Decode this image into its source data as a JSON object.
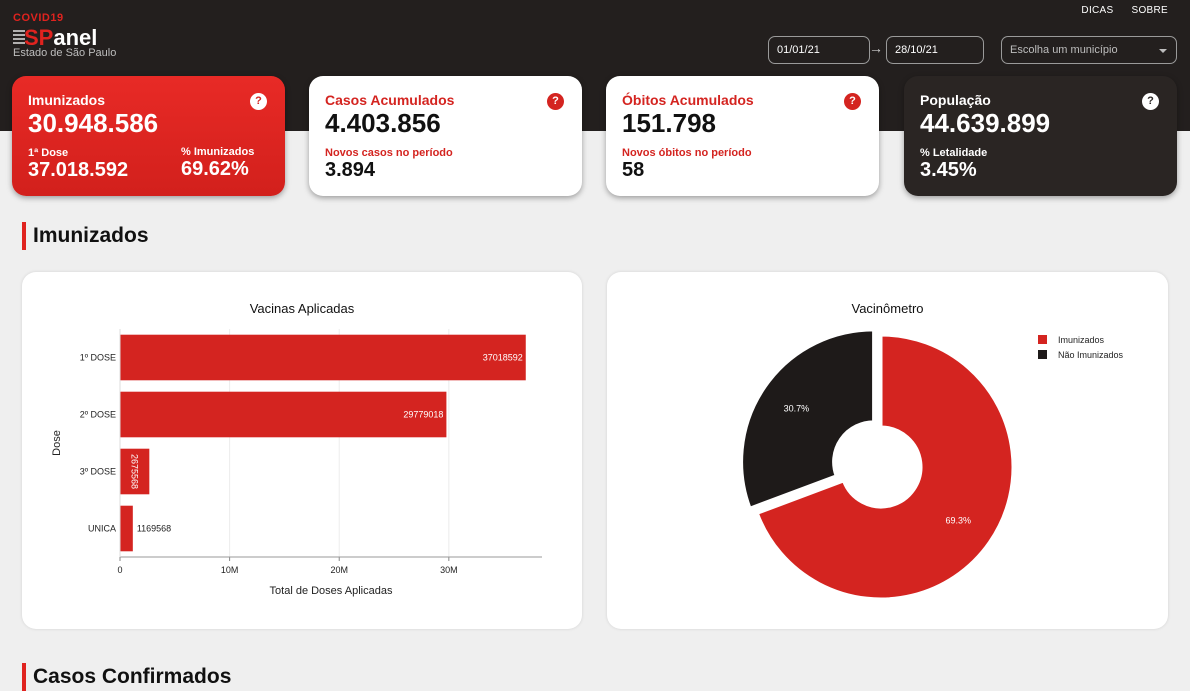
{
  "brand": {
    "tag": "COVID19",
    "logo_sp": "SP",
    "logo_rest": "anel",
    "subtitle": "Estado de São Paulo"
  },
  "nav": {
    "tips": "DICAS",
    "about": "SOBRE"
  },
  "filters": {
    "date_start": "01/01/21",
    "date_end": "28/10/21",
    "municipality_placeholder": "Escolha um município"
  },
  "cards": {
    "immunized": {
      "title": "Imunizados",
      "value": "30.948.586",
      "dose1_label": "1ª Dose",
      "dose1_value": "37.018.592",
      "pct_label": "% Imunizados",
      "pct_value": "69.62%"
    },
    "cases": {
      "title": "Casos Acumulados",
      "value": "4.403.856",
      "period_label": "Novos casos no período",
      "period_value": "3.894"
    },
    "deaths": {
      "title": "Óbitos Acumulados",
      "value": "151.798",
      "period_label": "Novos óbitos no período",
      "period_value": "58"
    },
    "population": {
      "title": "População",
      "value": "44.639.899",
      "lethality_label": "% Letalidade",
      "lethality_value": "3.45%"
    },
    "help": "?"
  },
  "sections": {
    "immunized": "Imunizados",
    "confirmed": "Casos Confirmados"
  },
  "colors": {
    "accent": "#d42420",
    "dark": "#1e1a19"
  },
  "chart_data": [
    {
      "type": "bar",
      "orientation": "horizontal",
      "title": "Vacinas Aplicadas",
      "xlabel": "Total de Doses Aplicadas",
      "ylabel": "Dose",
      "categories": [
        "1º DOSE",
        "2º DOSE",
        "3º DOSE",
        "UNICA"
      ],
      "values": [
        37018592,
        29779018,
        2675568,
        1169568
      ],
      "data_labels": [
        "37018592",
        "29779018",
        "2675568",
        "1169568"
      ],
      "xlim": [
        0,
        38500000
      ],
      "xticks": [
        0,
        10000000,
        20000000,
        30000000
      ],
      "xtick_labels": [
        "0",
        "10M",
        "20M",
        "30M"
      ],
      "grid": true
    },
    {
      "type": "pie",
      "donut": true,
      "title": "Vacinômetro",
      "labels": [
        "Imunizados",
        "Não Imunizados"
      ],
      "values": [
        69.3,
        30.7
      ],
      "data_labels": [
        "69.3%",
        "30.7%"
      ],
      "colors": [
        "#d42420",
        "#1e1a19"
      ],
      "legend": "top-right"
    }
  ]
}
